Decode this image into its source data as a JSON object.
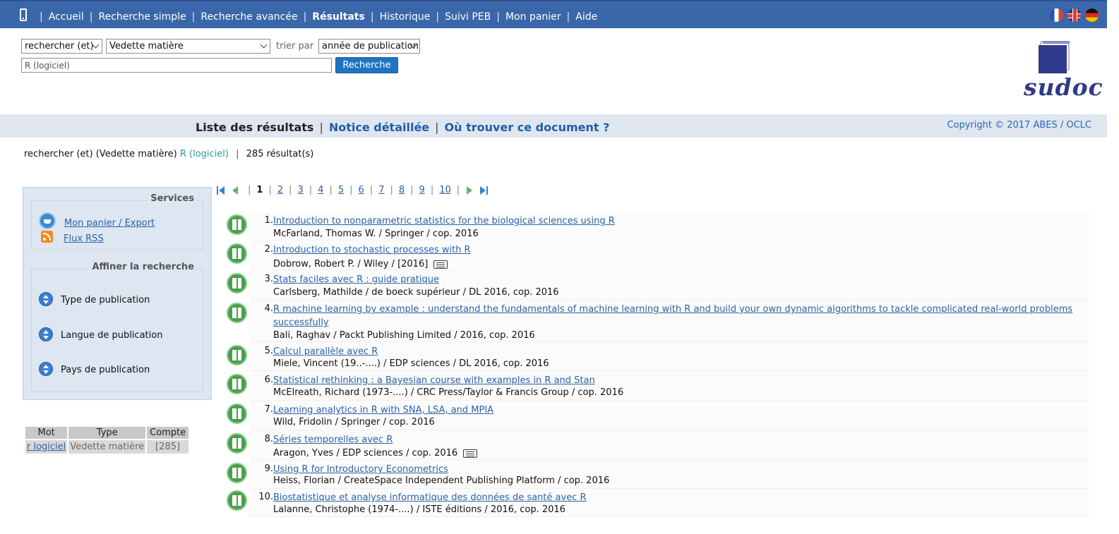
{
  "nav": {
    "items": [
      "Accueil",
      "Recherche simple",
      "Recherche avancée",
      "Résultats",
      "Historique",
      "Suivi PEB",
      "Mon panier",
      "Aide"
    ],
    "active": "Résultats"
  },
  "search": {
    "operator": "rechercher (et)",
    "index": "Vedette matière",
    "sort_label": "trier par",
    "sort_value": "année de publication",
    "query": "R (logiciel)",
    "button": "Recherche"
  },
  "logo": {
    "text": "sudoc"
  },
  "tabs": {
    "list": "Liste des résultats",
    "detail": "Notice détaillée",
    "where": "Où trouver ce document ?"
  },
  "copyright": "Copyright © 2017 ABES / OCLC",
  "summary": {
    "prefix": "rechercher (et) (Vedette matière)",
    "term": "R (logiciel)",
    "count": "285 résultat(s)"
  },
  "services": {
    "title": "Services",
    "basket": "Mon panier / Export",
    "rss": "Flux RSS"
  },
  "refine": {
    "title": "Affiner la recherche",
    "facets": [
      "Type de publication",
      "Langue de publication",
      "Pays de publication"
    ]
  },
  "terms_table": {
    "headers": [
      "Mot",
      "Type",
      "Compte"
    ],
    "row": {
      "mot": "r logiciel",
      "type": "Vedette matière",
      "compte": "[285]"
    }
  },
  "pager": {
    "current": "1",
    "pages": [
      "2",
      "3",
      "4",
      "5",
      "6",
      "7",
      "8",
      "9",
      "10"
    ]
  },
  "results": [
    {
      "num": "1.",
      "title": "Introduction to nonparametric statistics for the biological sciences using R",
      "author": "McFarland, Thomas W. / Springer / cop. 2016",
      "ebook": false
    },
    {
      "num": "2.",
      "title": "Introduction to stochastic processes with R",
      "author": "Dobrow, Robert P. / Wiley / [2016]",
      "ebook": true
    },
    {
      "num": "3.",
      "title": "Stats faciles avec R : guide pratique",
      "author": "Carlsberg, Mathilde / de boeck supérieur / DL 2016, cop. 2016",
      "ebook": false
    },
    {
      "num": "4.",
      "title": "R machine learning by example : understand the fundamentals of machine learning with R and build your own dynamic algorithms to tackle complicated real-world problems successfully",
      "author": "Bali, Raghav / Packt Publishing Limited / 2016, cop. 2016",
      "ebook": false
    },
    {
      "num": "5.",
      "title": "Calcul parallèle avec R",
      "author": "Miele, Vincent (19..-....) / EDP sciences / DL 2016, cop. 2016",
      "ebook": false
    },
    {
      "num": "6.",
      "title": "Statistical rethinking : a Bayesian course with examples in R and Stan",
      "author": "McElreath, Richard (1973-....) / CRC Press/Taylor & Francis Group / cop. 2016",
      "ebook": false
    },
    {
      "num": "7.",
      "title": "Learning analytics in R with SNA, LSA, and MPIA",
      "author": "Wild, Fridolin / Springer / cop. 2016",
      "ebook": false
    },
    {
      "num": "8.",
      "title": "Séries temporelles avec R",
      "author": "Aragon, Yves / EDP sciences / cop. 2016",
      "ebook": true
    },
    {
      "num": "9.",
      "title": "Using R for Introductory Econometrics",
      "author": "Heiss, Florian / CreateSpace Independent Publishing Platform / cop. 2016",
      "ebook": false
    },
    {
      "num": "10.",
      "title": "Biostatistique et analyse informatique des données de santé avec R",
      "author": "Lalanne, Christophe (1974-....) / ISTE éditions / 2016, cop. 2016",
      "ebook": false
    }
  ]
}
